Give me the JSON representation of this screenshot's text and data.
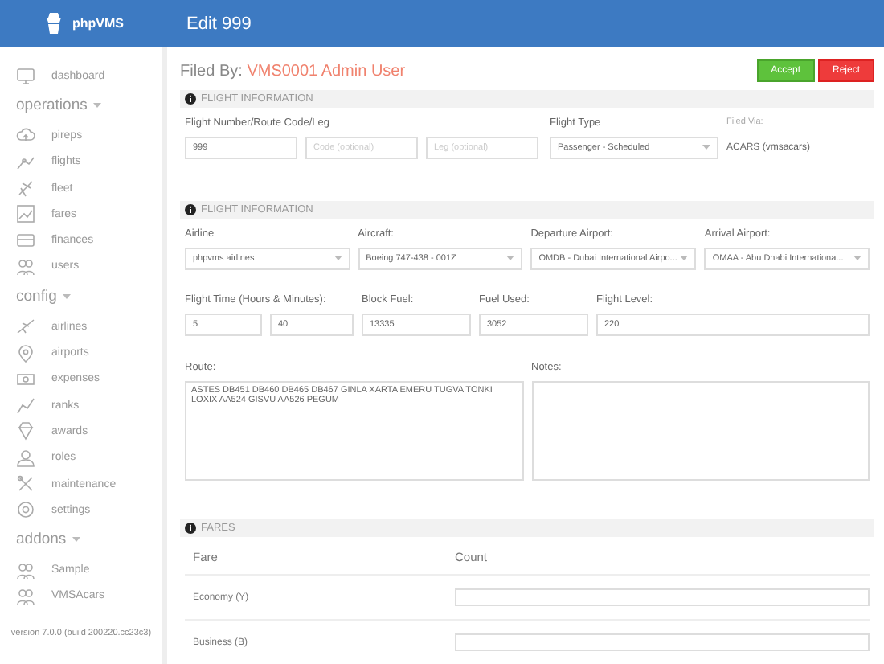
{
  "header": {
    "brand": "phpVMS",
    "title": "Edit 999"
  },
  "sidebar": {
    "groups": [
      {
        "items": [
          {
            "label": "dashboard"
          }
        ]
      },
      {
        "label": "operations",
        "items": [
          {
            "label": "pireps"
          },
          {
            "label": "flights"
          },
          {
            "label": "fleet"
          },
          {
            "label": "fares"
          },
          {
            "label": "finances"
          },
          {
            "label": "users"
          }
        ]
      },
      {
        "label": "config",
        "items": [
          {
            "label": "airlines"
          },
          {
            "label": "airports"
          },
          {
            "label": "expenses"
          },
          {
            "label": "ranks"
          },
          {
            "label": "awards"
          },
          {
            "label": "roles"
          },
          {
            "label": "maintenance"
          },
          {
            "label": "settings"
          }
        ]
      },
      {
        "label": "addons",
        "items": [
          {
            "label": "Sample"
          },
          {
            "label": "VMSAcars"
          }
        ]
      }
    ],
    "version": "version 7.0.0 (build 200220.cc23c3)"
  },
  "filed_by": {
    "label": "Filed By:",
    "value": "VMS0001 Admin User"
  },
  "buttons": [
    {
      "label": "Accept",
      "kind": "accept"
    },
    {
      "label": "Reject",
      "kind": "reject"
    }
  ],
  "sections": [
    {
      "title": "FLIGHT INFORMATION",
      "kind": "flight_number",
      "flight_number": {
        "label": "Flight Number/Route Code/Leg",
        "fields": [
          {
            "value": "999"
          },
          {
            "placeholder": "Code (optional)"
          },
          {
            "placeholder": "Leg (optional)"
          }
        ]
      },
      "flight_type": {
        "label": "Flight Type",
        "value": "Passenger - Scheduled"
      },
      "filed_via": {
        "label": "Filed Via:",
        "value": "ACARS (vmsacars)"
      }
    },
    {
      "title": "FLIGHT INFORMATION",
      "kind": "details",
      "selects": [
        {
          "label": "Airline",
          "value": "phpvms airlines"
        },
        {
          "label": "Aircraft:",
          "value": "Boeing 747-438 - 001Z"
        },
        {
          "label": "Departure Airport:",
          "value": "OMDB - Dubai International Airpo..."
        },
        {
          "label": "Arrival Airport:",
          "value": "OMAA - Abu Dhabi Internationa..."
        }
      ],
      "flight_time": {
        "label": "Flight Time (Hours & Minutes):",
        "hours": "5",
        "minutes": "40"
      },
      "inputs": [
        {
          "label": "Block Fuel:",
          "value": "13335"
        },
        {
          "label": "Fuel Used:",
          "value": "3052"
        },
        {
          "label": "Flight Level:",
          "value": "220"
        }
      ],
      "route": {
        "label": "Route:",
        "value": "ASTES DB451 DB460 DB465 DB467 GINLA XARTA EMERU TUGVA TONKI LOXIX AA524 GISVU AA526 PEGUM"
      },
      "notes": {
        "label": "Notes:"
      }
    },
    {
      "title": "FARES",
      "kind": "fares",
      "columns": [
        "Fare",
        "Count"
      ],
      "rows": [
        {
          "fare": "Economy (Y)"
        },
        {
          "fare": "Business (B)"
        }
      ]
    }
  ]
}
